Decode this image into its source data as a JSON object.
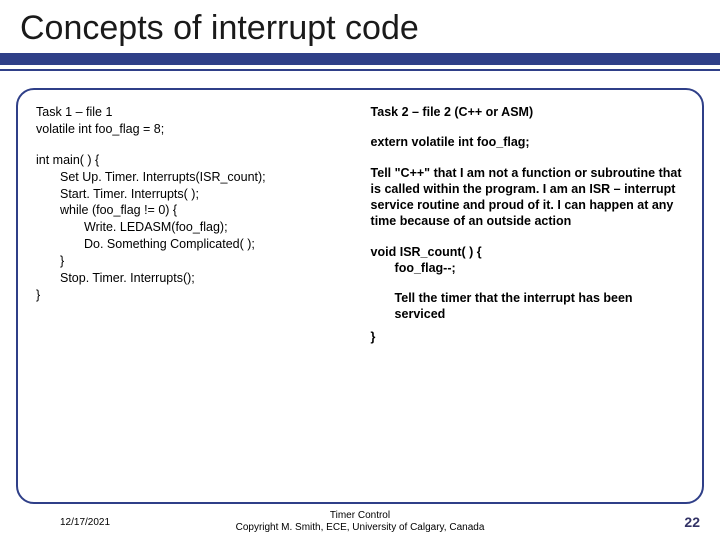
{
  "title": "Concepts of interrupt code",
  "left": {
    "head1": "Task 1 – file 1",
    "head2": "volatile int foo_flag = 8;",
    "l0": "int main( ) {",
    "l1": "Set Up. Timer. Interrupts(ISR_count);",
    "l2": "Start. Timer. Interrupts( );",
    "l3": "while (foo_flag != 0) {",
    "l4": "Write. LEDASM(foo_flag);",
    "l5": "Do. Something Complicated( );",
    "l6": "}",
    "l7": "Stop. Timer. Interrupts();",
    "l8": "}"
  },
  "right": {
    "head": "Task 2 – file 2  (C++ or ASM)",
    "extern": "extern volatile int foo_flag;",
    "p1": "Tell \"C++\" that I am not a function or subroutine that is called within the program. I am an ISR – interrupt service routine  and proud of it. I can happen at any time because of an outside action",
    "c0": "void ISR_count( ) {",
    "c1": "foo_flag--;",
    "p2": "Tell the timer that the interrupt has been serviced",
    "c2": "}"
  },
  "footer": {
    "date": "12/17/2021",
    "center1": "Timer Control",
    "center2": "Copyright M. Smith, ECE, University of Calgary, Canada",
    "page": "22"
  }
}
